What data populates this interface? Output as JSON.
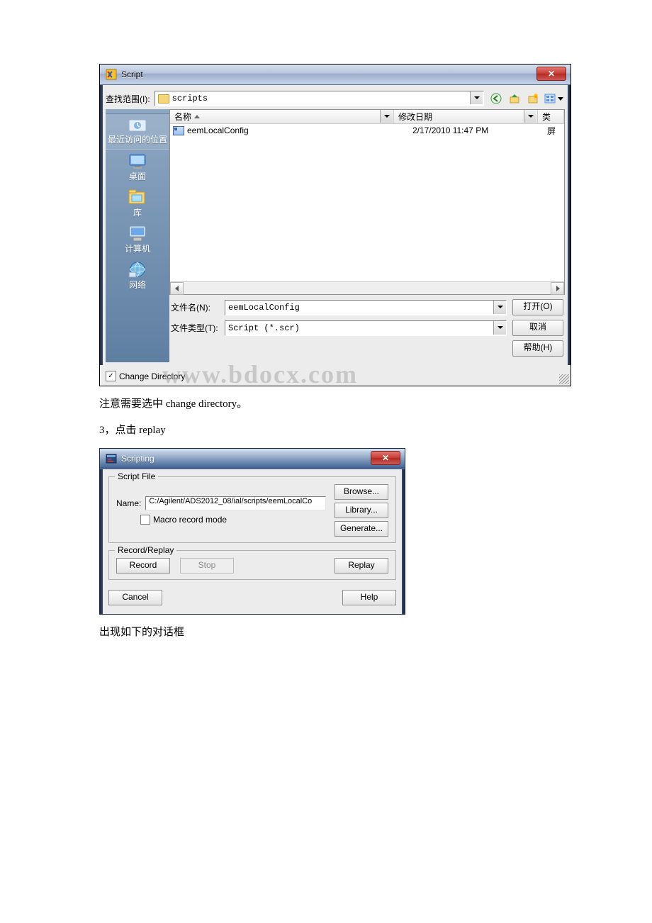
{
  "fileDialog": {
    "title": "Script",
    "lookIn_label": "查找范围(I):",
    "lookIn_value": "scripts",
    "columns": {
      "name": "名称",
      "date": "修改日期",
      "type": "类"
    },
    "type_clipped": "屏",
    "files": [
      {
        "name": "eemLocalConfig",
        "date": "2/17/2010 11:47 PM"
      }
    ],
    "sidebar": {
      "recent": "最近访问的位置",
      "desktop": "桌面",
      "library": "库",
      "computer": "计算机",
      "network": "网络"
    },
    "fileName_label": "文件名(N):",
    "fileName_value": "eemLocalConfig",
    "fileType_label": "文件类型(T):",
    "fileType_value": "Script (*.scr)",
    "open_btn": "打开(O)",
    "cancel_btn": "取消",
    "help_btn": "帮助(H)",
    "changeDir_label": "Change Directory",
    "watermark": "www.bdocx.com"
  },
  "text": {
    "note1": "注意需要选中 change directory。",
    "step3": "3，点击 replay",
    "note2": "出现如下的对话框"
  },
  "scriptingDialog": {
    "title": "Scripting",
    "group1": "Script File",
    "name_label": "Name:",
    "name_value": "C:/Agilent/ADS2012_08/ial/scripts/eemLocalCo",
    "macro_label": "Macro record mode",
    "browse_btn": "Browse...",
    "library_btn": "Library...",
    "generate_btn": "Generate...",
    "group2": "Record/Replay",
    "record_btn": "Record",
    "stop_btn": "Stop",
    "replay_btn": "Replay",
    "cancel_btn": "Cancel",
    "help_btn": "Help"
  }
}
